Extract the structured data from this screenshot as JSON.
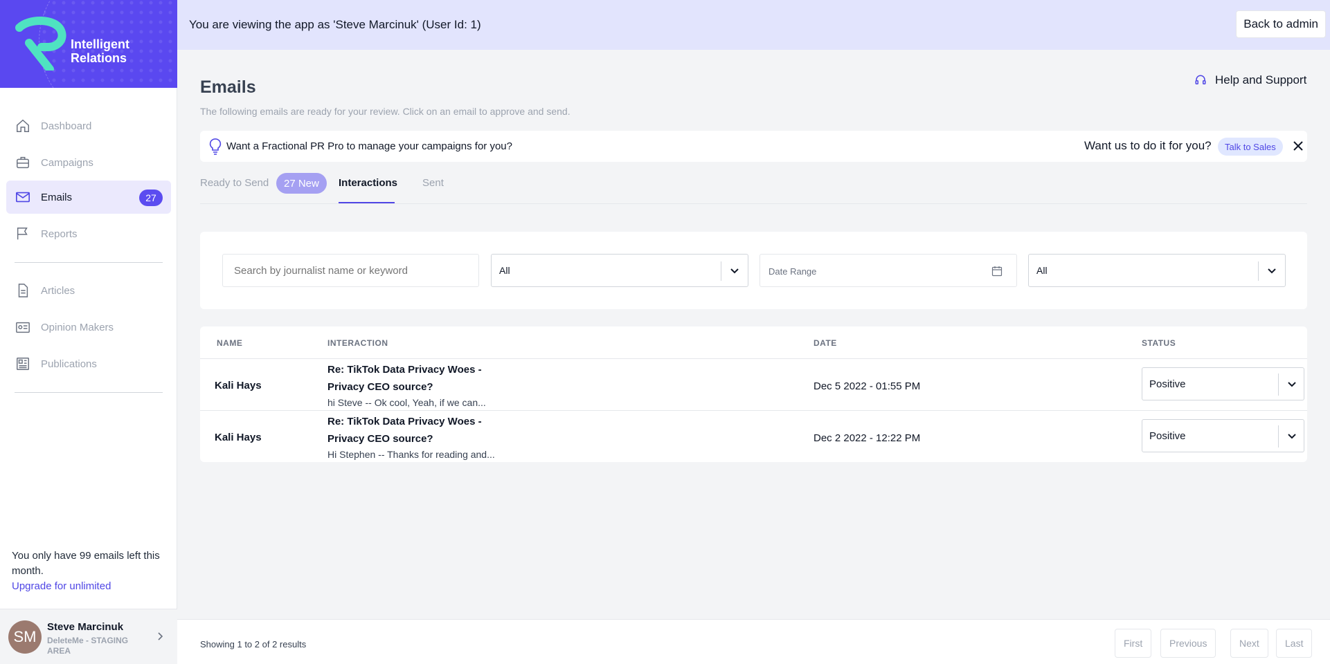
{
  "brand": {
    "line1": "Intelligent",
    "line2": "Relations",
    "accent": "#5a48f0",
    "logo_accent": "#4fe3c1"
  },
  "nav": {
    "items": [
      {
        "label": "Dashboard",
        "icon": "home-icon"
      },
      {
        "label": "Campaigns",
        "icon": "briefcase-icon"
      },
      {
        "label": "Emails",
        "icon": "mail-icon",
        "badge": "27",
        "active": true
      },
      {
        "label": "Reports",
        "icon": "flag-icon"
      },
      {
        "label": "Articles",
        "icon": "document-icon"
      },
      {
        "label": "Opinion Makers",
        "icon": "id-card-icon"
      },
      {
        "label": "Publications",
        "icon": "newspaper-icon"
      }
    ]
  },
  "quota": {
    "text": "You only have 99 emails left this month.",
    "upgrade_link": "Upgrade for unlimited"
  },
  "profile": {
    "initials": "SM",
    "name": "Steve Marcinuk",
    "org": "DeleteMe - STAGING AREA"
  },
  "banner": {
    "text": "You are viewing the app as 'Steve Marcinuk' (User Id: 1)",
    "back_button": "Back to admin"
  },
  "page": {
    "title": "Emails",
    "subtitle": "The following emails are ready for your review. Click on an email to approve and send.",
    "help_link": "Help and Support"
  },
  "promo": {
    "text": "Want a Fractional PR Pro to manage your campaigns for you?",
    "ask": "Want us to do it for you?",
    "cta": "Talk to Sales"
  },
  "tabs": [
    {
      "label": "Ready to Send",
      "badge": "27 New"
    },
    {
      "label": "Interactions",
      "active": true
    },
    {
      "label": "Sent"
    }
  ],
  "filters": {
    "search_placeholder": "Search by journalist name or keyword",
    "select1_value": "All",
    "date_placeholder": "Date Range",
    "select2_value": "All"
  },
  "table": {
    "headers": {
      "name": "NAME",
      "interaction": "INTERACTION",
      "date": "DATE",
      "status": "STATUS"
    },
    "rows": [
      {
        "name": "Kali Hays",
        "subject": "Re: TikTok Data Privacy Woes - Privacy CEO source?",
        "snippet": "hi Steve -- Ok cool, Yeah, if we can...",
        "date": "Dec 5 2022 - 01:55 PM",
        "status": "Positive"
      },
      {
        "name": "Kali Hays",
        "subject": "Re: TikTok Data Privacy Woes - Privacy CEO source?",
        "snippet": "Hi Stephen -- Thanks for reading and...",
        "date": "Dec 2 2022 - 12:22 PM",
        "status": "Positive"
      }
    ]
  },
  "pagination": {
    "showing": "Showing 1 to 2 of 2 results",
    "first": "First",
    "previous": "Previous",
    "next": "Next",
    "last": "Last"
  }
}
